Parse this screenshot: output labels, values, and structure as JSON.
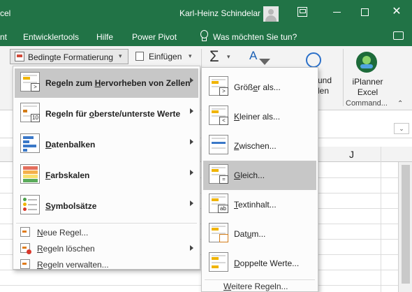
{
  "titlebar": {
    "app_partial": "cel",
    "user": "Karl-Heinz Schindelar",
    "close_glyph": "✕"
  },
  "tabs": {
    "partial": "nt",
    "developer": "Entwicklertools",
    "help": "Hilfe",
    "power_pivot": "Power Pivot",
    "tell_me": "Was möchten Sie tun?"
  },
  "ribbon": {
    "conditional_formatting": "Bedingte Formatierung",
    "insert": "Einfügen",
    "sigma": "Σ",
    "sort_glyph": "A",
    "partial_line1": "und",
    "partial_line2": "len",
    "iplanner_line1": "iPlanner",
    "iplanner_line2": "Excel",
    "commands_group": "Command...",
    "dropdown_glyph": "⌄",
    "collapse_glyph": "⌃"
  },
  "sheet": {
    "column_j": "J"
  },
  "menu": {
    "items": [
      {
        "label": "Regeln zum Hervorheben von Zellen",
        "icon": "highlight-cells-rules-icon",
        "badge": ">"
      },
      {
        "label": "Regeln für oberste/unterste Werte",
        "icon": "top-bottom-rules-icon",
        "badge": "10"
      },
      {
        "label": "Datenbalken",
        "icon": "data-bars-icon"
      },
      {
        "label": "Farbskalen",
        "icon": "color-scales-icon"
      },
      {
        "label": "Symbolsätze",
        "icon": "icon-sets-icon"
      }
    ],
    "small_items": [
      {
        "label": "Neue Regel...",
        "icon": "new-rule-icon"
      },
      {
        "label": "Regeln löschen",
        "icon": "clear-rules-icon"
      },
      {
        "label": "Regeln verwalten...",
        "icon": "manage-rules-icon"
      }
    ]
  },
  "submenu": {
    "items": [
      {
        "label": "Größer als...",
        "badge": ">"
      },
      {
        "label": "Kleiner als...",
        "badge": "<"
      },
      {
        "label": "Zwischen..."
      },
      {
        "label": "Gleich...",
        "badge": "="
      },
      {
        "label": "Textinhalt...",
        "badge": "ab"
      },
      {
        "label": "Datum..."
      },
      {
        "label": "Doppelte Werte..."
      }
    ],
    "more": "Weitere Regeln..."
  },
  "colors": {
    "accent": "#217346",
    "highlight": "#c7c7c7",
    "cell_mark": "#f0b400"
  }
}
